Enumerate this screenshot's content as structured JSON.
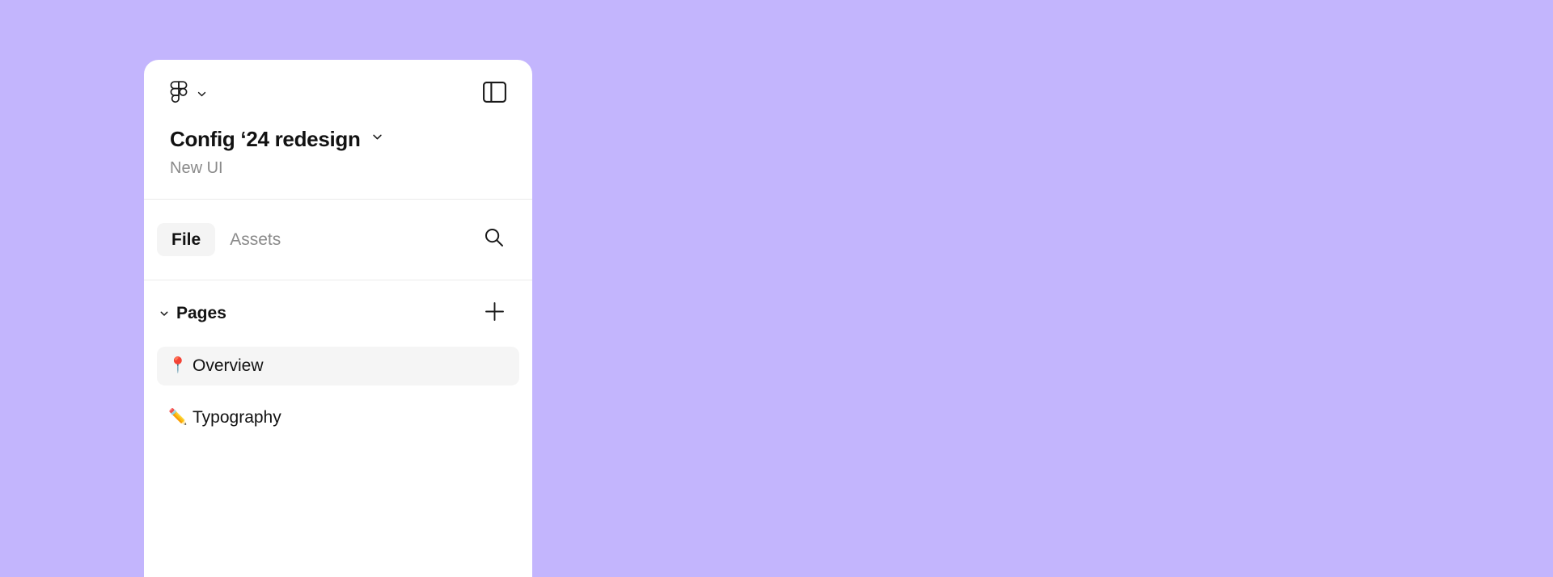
{
  "theme": {
    "background": "#c3b5fd",
    "panel_background": "#ffffff",
    "divider": "#ebebeb",
    "active_tab_bg": "#f4f4f4",
    "selected_row_bg": "#f5f5f5",
    "text_primary": "#121212",
    "text_muted": "#8a8a8a"
  },
  "panel": {
    "brand": {
      "logo_icon": "figma-logo-icon",
      "menu_caret_icon": "chevron-down-icon"
    },
    "panel_toggle_icon": "left-panel-toggle-icon",
    "file": {
      "title": "Config ‘24 redesign",
      "title_caret_icon": "chevron-down-icon",
      "subtitle": "New UI"
    },
    "tabs": [
      {
        "label": "File",
        "active": true
      },
      {
        "label": "Assets",
        "active": false
      }
    ],
    "search_icon": "search-icon",
    "pages_section": {
      "caret_icon": "chevron-down-icon",
      "title": "Pages",
      "add_icon": "plus-icon",
      "items": [
        {
          "emoji": "📍",
          "emoji_name": "pushpin-emoji",
          "label": "Overview",
          "selected": true
        },
        {
          "emoji": "✏️",
          "emoji_name": "pencil-emoji",
          "label": "Typography",
          "selected": false
        }
      ]
    }
  }
}
